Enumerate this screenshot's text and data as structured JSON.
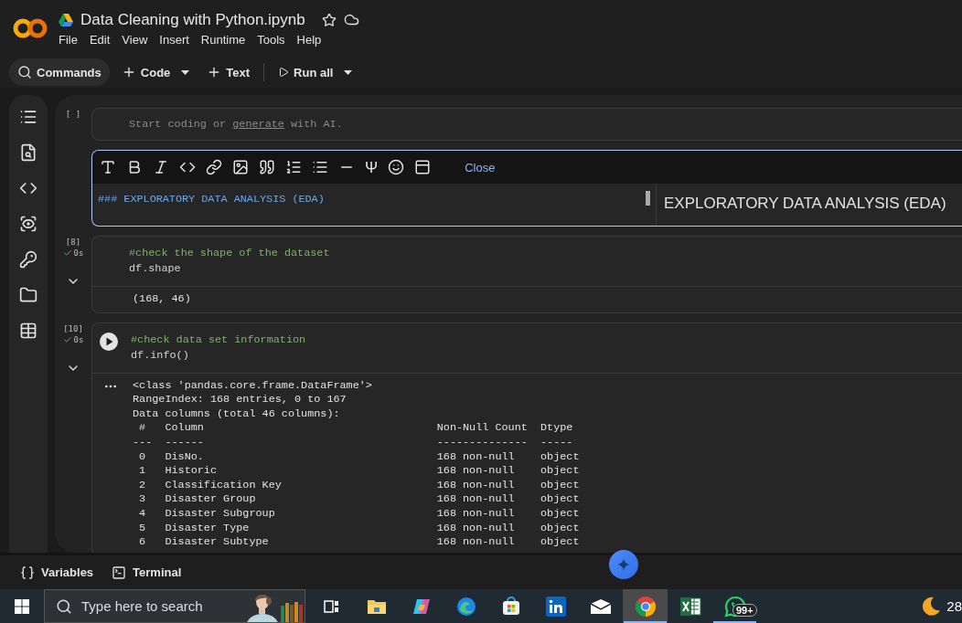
{
  "header": {
    "title": "Data Cleaning with Python.ipynb",
    "menu": [
      "File",
      "Edit",
      "View",
      "Insert",
      "Runtime",
      "Tools",
      "Help"
    ]
  },
  "toolbar": {
    "items": [
      {
        "kind": "search",
        "label": "Commands",
        "dropdown": false
      },
      {
        "kind": "add",
        "label": "Code",
        "dropdown": true
      },
      {
        "kind": "add",
        "label": "Text",
        "dropdown": false
      },
      {
        "kind": "run",
        "label": "Run all",
        "dropdown": true
      }
    ]
  },
  "cells": [
    {
      "kind": "empty",
      "execution": "[ ]",
      "placeholder_before": "Start coding or ",
      "placeholder_link": "generate",
      "placeholder_after": " with AI."
    },
    {
      "kind": "markdown",
      "latex_symbol": "Ψ",
      "close_label": "Close",
      "source": "### EXPLORATORY DATA ANALYSIS (EDA)",
      "preview": "EXPLORATORY DATA ANALYSIS (EDA)"
    },
    {
      "kind": "code",
      "execution": "[8]",
      "done": true,
      "duration": "0s",
      "run_button": false,
      "source": [
        {
          "kind": "comment",
          "text": "#check the shape of the dataset"
        },
        {
          "kind": "code",
          "text": "df.shape"
        }
      ],
      "output": {
        "expanded": true,
        "more_menu": false,
        "lines": [
          "(168, 46)"
        ]
      }
    },
    {
      "kind": "code",
      "execution": "[10]",
      "done": true,
      "duration": "0s",
      "run_button": true,
      "source": [
        {
          "kind": "comment",
          "text": "#check data set information"
        },
        {
          "kind": "code",
          "text": "df.info()"
        }
      ],
      "output": {
        "expanded": true,
        "more_menu": true,
        "lines": [
          "<class 'pandas.core.frame.DataFrame'>",
          "RangeIndex: 168 entries, 0 to 167",
          "Data columns (total 46 columns):"
        ],
        "table": {
          "columns": [
            "#",
            "Column",
            "Non-Null Count",
            "Dtype"
          ],
          "rules": [
            "---",
            "------",
            "--------------",
            "-----"
          ],
          "rows": [
            [
              "0",
              "DisNo.",
              "168 non-null",
              "object"
            ],
            [
              "1",
              "Historic",
              "168 non-null",
              "object"
            ],
            [
              "2",
              "Classification Key",
              "168 non-null",
              "object"
            ],
            [
              "3",
              "Disaster Group",
              "168 non-null",
              "object"
            ],
            [
              "4",
              "Disaster Subgroup",
              "168 non-null",
              "object"
            ],
            [
              "5",
              "Disaster Type",
              "168 non-null",
              "object"
            ],
            [
              "6",
              "Disaster Subtype",
              "168 non-null",
              "object"
            ]
          ]
        }
      }
    }
  ],
  "bottom_bar": {
    "items": [
      {
        "kind": "variables",
        "label": "Variables"
      },
      {
        "kind": "terminal",
        "label": "Terminal"
      }
    ]
  },
  "taskbar": {
    "search_placeholder": "Type here to search",
    "apps": [
      {
        "kind": "taskview",
        "running": false,
        "selected": false
      },
      {
        "kind": "explorer",
        "running": false,
        "selected": false
      },
      {
        "kind": "copilot",
        "running": false,
        "selected": false
      },
      {
        "kind": "edge",
        "running": false,
        "selected": false
      },
      {
        "kind": "store",
        "running": false,
        "selected": false
      },
      {
        "kind": "linkedin",
        "running": false,
        "selected": false
      },
      {
        "kind": "mail",
        "running": false,
        "selected": false
      },
      {
        "kind": "chrome",
        "running": true,
        "selected": true
      },
      {
        "kind": "excel",
        "running": false,
        "selected": false
      },
      {
        "kind": "whatsapp",
        "running": true,
        "selected": false,
        "badge": "99+"
      }
    ],
    "temperature": "28"
  }
}
